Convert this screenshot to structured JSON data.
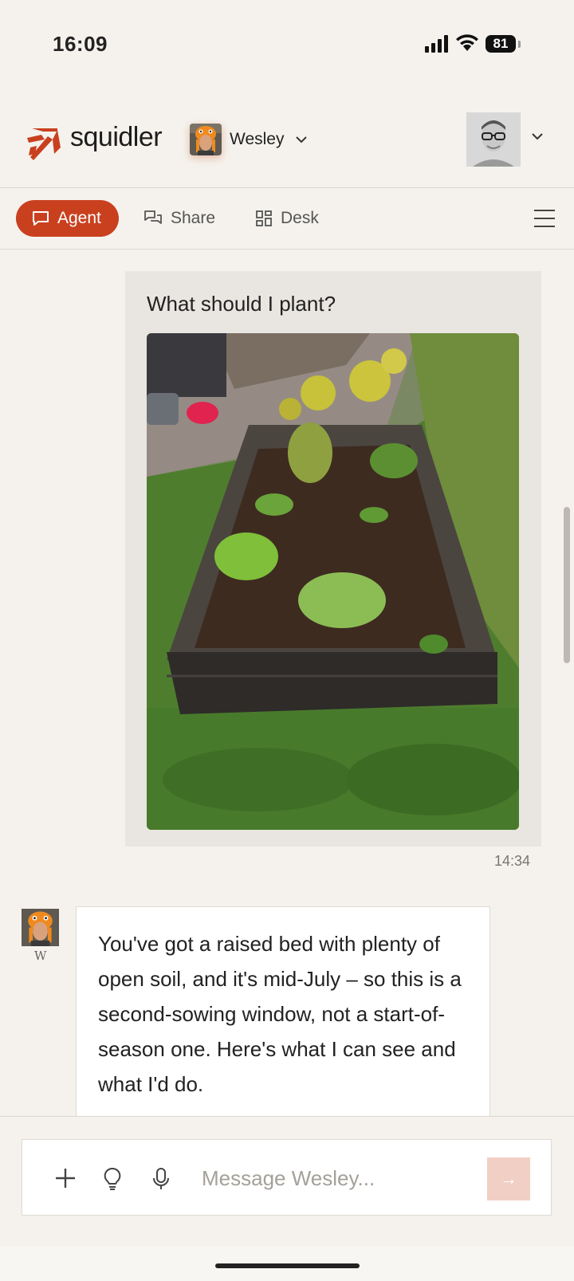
{
  "status_bar": {
    "time": "16:09",
    "battery": "81",
    "icons": [
      "signal-icon",
      "wifi-icon",
      "battery-icon"
    ]
  },
  "header": {
    "brand": "squidler",
    "agent_name": "Wesley",
    "accent_color": "#c9401f"
  },
  "tabs": [
    {
      "label": "Agent",
      "icon": "chat-bubble-icon",
      "active": true
    },
    {
      "label": "Share",
      "icon": "share-chat-icon",
      "active": false
    },
    {
      "label": "Desk",
      "icon": "grid-icon",
      "active": false
    }
  ],
  "conversation": {
    "user_message": {
      "text": "What should I plant?",
      "image": "raised garden bed photo",
      "time": "14:34"
    },
    "agent_message": {
      "initial": "W",
      "text": "You've got a raised bed with plenty of open soil, and it's mid-July – so this is a second-sowing window, not a start-of-season one. Here's what I can see and what I'd do."
    }
  },
  "composer": {
    "placeholder": "Message Wesley...",
    "value": "",
    "send_label": "→"
  }
}
